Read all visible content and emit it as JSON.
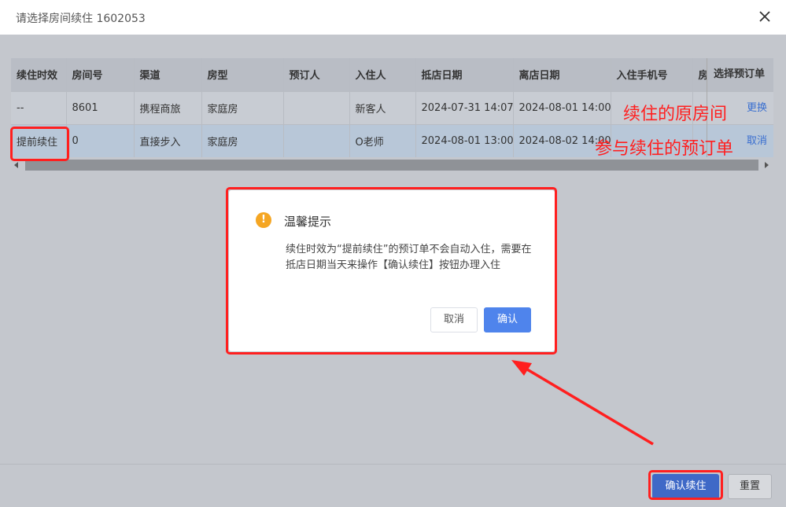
{
  "window": {
    "title": "请选择房间续住 1602053"
  },
  "table": {
    "columns": [
      "续住时效",
      "房间号",
      "渠道",
      "房型",
      "预订人",
      "入住人",
      "抵店日期",
      "离店日期",
      "入住手机号",
      "房"
    ],
    "rows": [
      [
        "--",
        "8601",
        "携程商旅",
        "家庭房",
        "",
        "新客人",
        "2024-07-31 14:07",
        "2024-08-01 14:00",
        "",
        ""
      ],
      [
        "提前续住",
        "0",
        "直接步入",
        "家庭房",
        "",
        "O老师",
        "2024-08-01 13:00",
        "2024-08-02 14:00",
        "",
        ""
      ]
    ],
    "action_column": {
      "header": "选择预订单",
      "row_actions": [
        "更换",
        "取消"
      ]
    }
  },
  "annotations": {
    "original_room": "续住的原房间",
    "participating_booking": "参与续住的预订单",
    "color": "#ff1f1f"
  },
  "dialog": {
    "icon": "warning-icon",
    "title": "温馨提示",
    "message": "续住时效为“提前续住”的预订单不会自动入住，需要在抵店日期当天来操作【确认续住】按钮办理入住",
    "cancel_label": "取消",
    "confirm_label": "确认"
  },
  "footer": {
    "confirm_label": "确认续住",
    "reset_label": "重置"
  },
  "colors": {
    "primary": "#4f84ec",
    "link": "#3a6fd0",
    "warning": "#f5a623"
  }
}
